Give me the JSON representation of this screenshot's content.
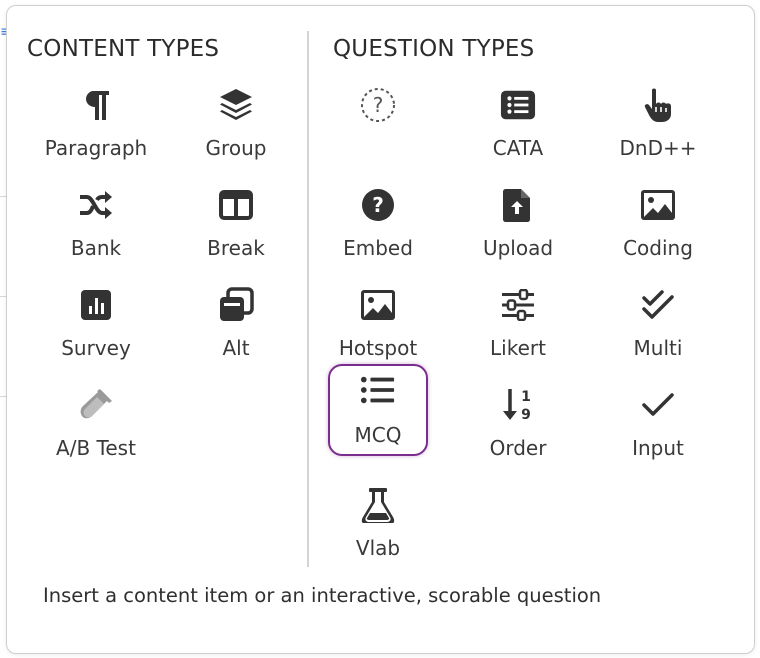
{
  "content_types": {
    "heading": "CONTENT TYPES",
    "items": [
      {
        "label": "Paragraph",
        "icon": "paragraph-icon"
      },
      {
        "label": "Group",
        "icon": "layers-icon"
      },
      {
        "label": "Bank",
        "icon": "shuffle-icon"
      },
      {
        "label": "Break",
        "icon": "columns-icon"
      },
      {
        "label": "Survey",
        "icon": "bar-chart-icon"
      },
      {
        "label": "Alt",
        "icon": "copy-icon"
      },
      {
        "label": "A/B Test",
        "icon": "test-tube-icon"
      }
    ]
  },
  "question_types": {
    "heading": "QUESTION TYPES",
    "items": [
      {
        "label": "",
        "icon": "question-dashed-icon"
      },
      {
        "label": "CATA",
        "icon": "list-box-icon"
      },
      {
        "label": "DnD++",
        "icon": "hand-pointer-icon"
      },
      {
        "label": "Embed",
        "icon": "question-circle-icon"
      },
      {
        "label": "Upload",
        "icon": "file-upload-icon"
      },
      {
        "label": "Coding",
        "icon": "image-icon"
      },
      {
        "label": "Hotspot",
        "icon": "image-icon"
      },
      {
        "label": "Likert",
        "icon": "sliders-icon"
      },
      {
        "label": "Multi",
        "icon": "double-check-icon"
      },
      {
        "label": "MCQ",
        "icon": "list-icon",
        "selected": true
      },
      {
        "label": "Order",
        "icon": "sort-numeric-icon"
      },
      {
        "label": "Input",
        "icon": "check-icon"
      },
      {
        "label": "Vlab",
        "icon": "flask-icon"
      }
    ]
  },
  "footer": "Insert a content item or an interactive, scorable question",
  "colors": {
    "icon": "#333333",
    "disabled_icon": "#9a9a9a",
    "selected_border": "#7b2d8e"
  }
}
